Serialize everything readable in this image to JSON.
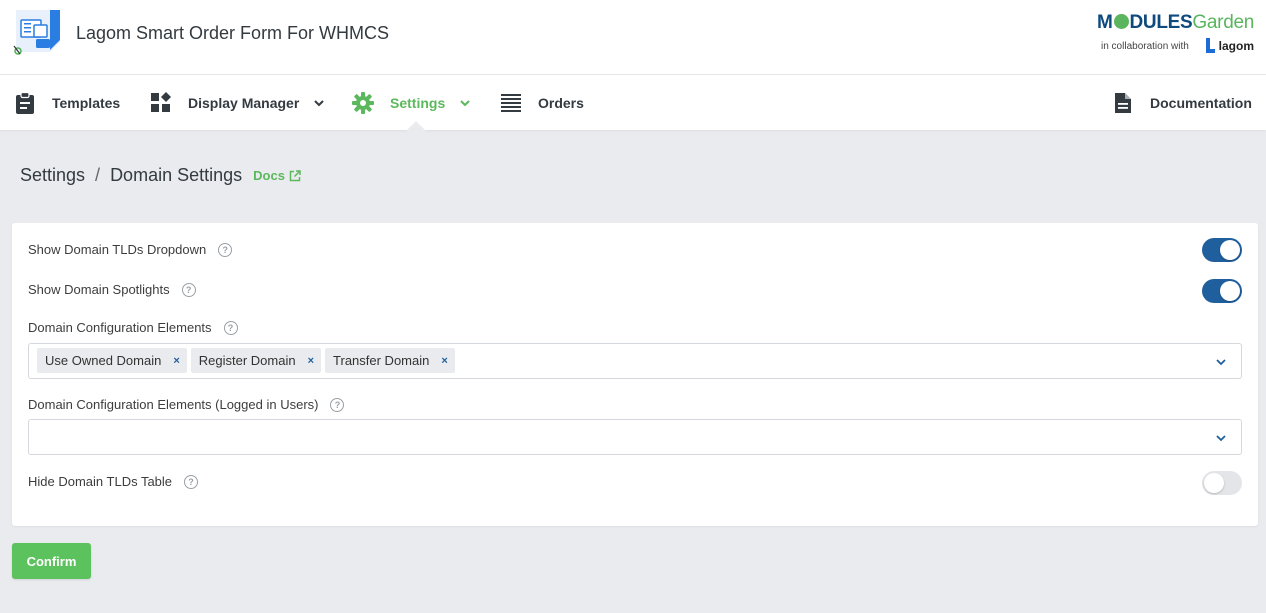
{
  "header": {
    "app_title": "Lagom Smart Order Form For WHMCS",
    "brand": {
      "modules_pre": "M",
      "modules_post": "DULES",
      "garden": "Garden",
      "collab": "in collaboration with",
      "lagom": "lagom"
    }
  },
  "nav": {
    "items": [
      {
        "label": "Templates",
        "icon": "clipboard-icon"
      },
      {
        "label": "Display Manager",
        "icon": "widgets-icon",
        "has_dropdown": true
      },
      {
        "label": "Settings",
        "icon": "gear-icon",
        "has_dropdown": true,
        "active": true
      },
      {
        "label": "Orders",
        "icon": "list-icon"
      }
    ],
    "right": {
      "label": "Documentation",
      "icon": "document-icon"
    }
  },
  "breadcrumb": {
    "parent": "Settings",
    "separator": "/",
    "current": "Domain Settings",
    "docs": "Docs"
  },
  "form": {
    "show_tlds_dropdown": {
      "label": "Show Domain TLDs Dropdown",
      "enabled": true
    },
    "show_spotlights": {
      "label": "Show Domain Spotlights",
      "enabled": true
    },
    "config_elements": {
      "label": "Domain Configuration Elements",
      "tags": [
        "Use Owned Domain",
        "Register Domain",
        "Transfer Domain"
      ],
      "remove_glyph": "×"
    },
    "config_elements_logged": {
      "label": "Domain Configuration Elements (Logged in Users)",
      "tags": []
    },
    "hide_tlds_table": {
      "label": "Hide Domain TLDs Table",
      "enabled": false
    },
    "help_glyph": "?"
  },
  "actions": {
    "confirm": "Confirm"
  },
  "colors": {
    "accent_green": "#5cb85c",
    "toggle_on": "#1f5f9e",
    "brand_blue": "#0f4a7e"
  }
}
